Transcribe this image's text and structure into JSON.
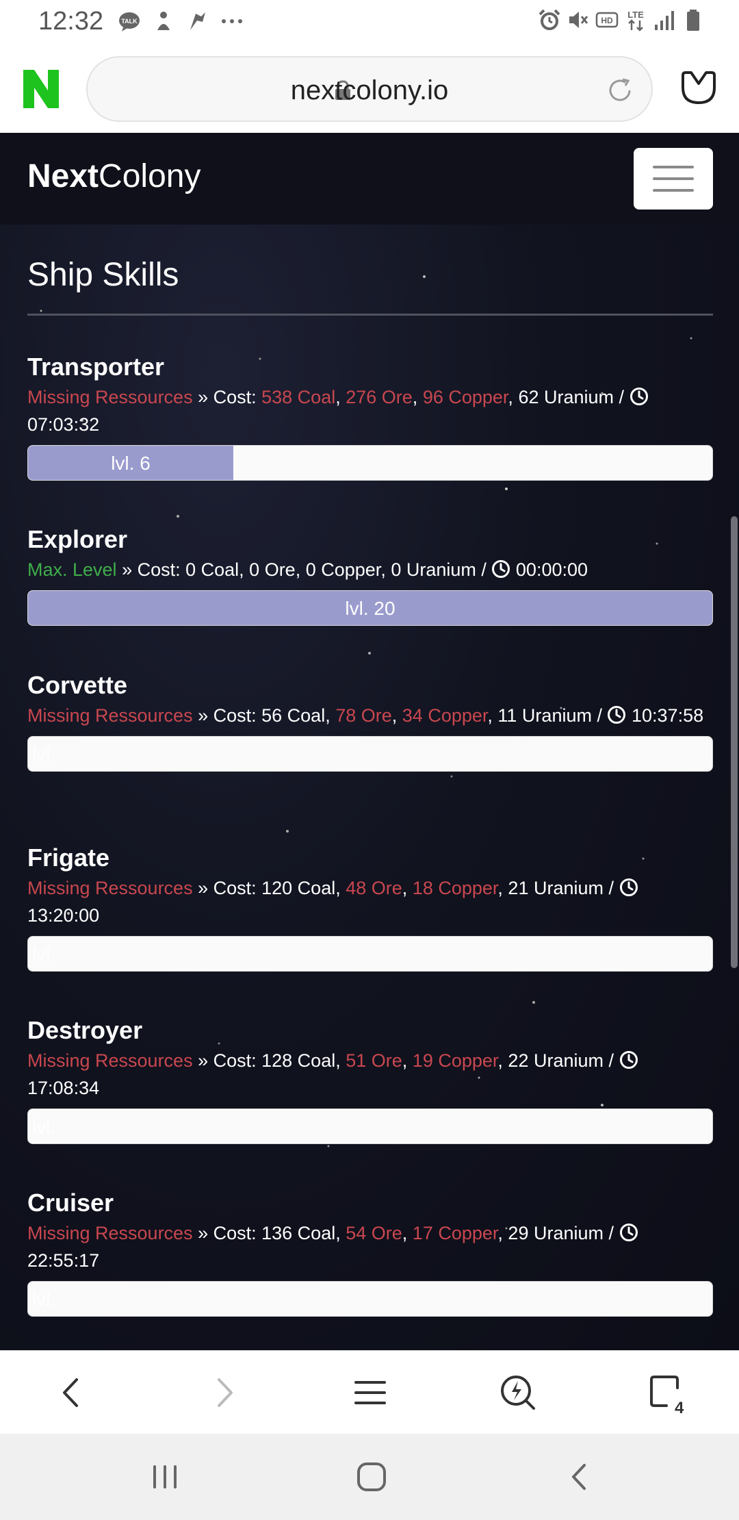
{
  "status_bar": {
    "time": "12:32",
    "left_icons": [
      "talk-icon",
      "notification-icon",
      "notification-icon",
      "more-dots-icon"
    ],
    "right_icons": [
      "alarm-icon",
      "mute-icon",
      "hd-icon",
      "lte-icon",
      "signal-icon",
      "battery-icon"
    ]
  },
  "browser": {
    "url": "nextcolony.io",
    "tab_count": "4"
  },
  "site": {
    "brand_bold": "Next",
    "brand_regular": "Colony"
  },
  "section": {
    "title": "Ship Skills"
  },
  "skills": [
    {
      "name": "Transporter",
      "status": "Missing Ressources",
      "cost_label": " » Cost: ",
      "coal": "538 Coal",
      "ore": "276 Ore",
      "copper": "96 Copper",
      "uranium": "62 Uranium",
      "time": "07:03:32",
      "level_label": "lvl. 6",
      "progress": 0.3
    },
    {
      "name": "Explorer",
      "status": "Max. Level",
      "cost_label": " » Cost: ",
      "coal": "0 Coal",
      "ore": "0 Ore",
      "copper": "0 Copper",
      "uranium": "0 Uranium",
      "time": "00:00:00",
      "level_label": "lvl. 20",
      "progress": 1.0
    },
    {
      "name": "Corvette",
      "status": "Missing Ressources",
      "cost_label": " » Cost: ",
      "coal": "56 Coal",
      "ore": "78 Ore",
      "copper": "34 Copper",
      "uranium": "11 Uranium",
      "time": "10:37:58",
      "level_label": "lvl.",
      "progress": 0
    },
    {
      "name": "Frigate",
      "status": "Missing Ressources",
      "cost_label": " » Cost: ",
      "coal": "120 Coal",
      "ore": "48 Ore",
      "copper": "18 Copper",
      "uranium": "21 Uranium",
      "time": "13:20:00",
      "level_label": "lvl.",
      "progress": 0
    },
    {
      "name": "Destroyer",
      "status": "Missing Ressources",
      "cost_label": " » Cost: ",
      "coal": "128 Coal",
      "ore": "51 Ore",
      "copper": "19 Copper",
      "uranium": "22 Uranium",
      "time": "17:08:34",
      "level_label": "lvl.",
      "progress": 0
    },
    {
      "name": "Cruiser",
      "status": "Missing Ressources",
      "cost_label": " » Cost: ",
      "coal": "136 Coal",
      "ore": "54 Ore",
      "copper": "17 Copper",
      "uranium": "29 Uranium",
      "time": "22:55:17",
      "level_label": "lvl.",
      "progress": 0
    }
  ],
  "colors": {
    "missing": "#c9474f",
    "max_level": "#3fae49",
    "progress_fill": "#9a9bcd",
    "brand_green": "#1ec31e"
  }
}
